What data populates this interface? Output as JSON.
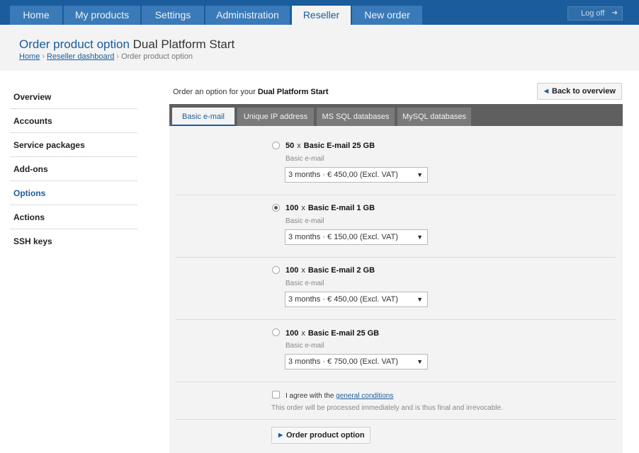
{
  "nav": {
    "tabs": [
      {
        "label": "Home"
      },
      {
        "label": "My products"
      },
      {
        "label": "Settings"
      },
      {
        "label": "Administration"
      },
      {
        "label": "Reseller",
        "active": true
      },
      {
        "label": "New order"
      }
    ],
    "logoff_label": "Log off",
    "logoff_icon": "arrow-right-icon"
  },
  "header": {
    "title_prefix": "Order product option",
    "title_product": "Dual Platform Start",
    "breadcrumb": {
      "home": "Home",
      "reseller": "Reseller dashboard",
      "current": "Order product option",
      "separator": "›"
    }
  },
  "sidebar": {
    "items": [
      {
        "label": "Overview"
      },
      {
        "label": "Accounts"
      },
      {
        "label": "Service packages"
      },
      {
        "label": "Add-ons"
      },
      {
        "label": "Options",
        "active": true
      },
      {
        "label": "Actions"
      },
      {
        "label": "SSH keys"
      }
    ]
  },
  "main": {
    "intro_prefix": "Order an option for your",
    "intro_product": "Dual Platform Start",
    "back_label": "Back to overview",
    "tabs": [
      {
        "label": "Basic e-mail",
        "active": true
      },
      {
        "label": "Unique IP address"
      },
      {
        "label": "MS SQL databases"
      },
      {
        "label": "MySQL databases"
      }
    ],
    "options": [
      {
        "qty": "50",
        "times": "x",
        "name": "Basic E-mail 25 GB",
        "category": "Basic e-mail",
        "price_select": "3 months · € 450,00 (Excl. VAT)",
        "selected": false
      },
      {
        "qty": "100",
        "times": "x",
        "name": "Basic E-mail 1 GB",
        "category": "Basic e-mail",
        "price_select": "3 months · € 150,00 (Excl. VAT)",
        "selected": true
      },
      {
        "qty": "100",
        "times": "x",
        "name": "Basic E-mail 2 GB",
        "category": "Basic e-mail",
        "price_select": "3 months · € 450,00 (Excl. VAT)",
        "selected": false
      },
      {
        "qty": "100",
        "times": "x",
        "name": "Basic E-mail 25 GB",
        "category": "Basic e-mail",
        "price_select": "3 months · € 750,00 (Excl. VAT)",
        "selected": false
      }
    ],
    "agree_prefix": "I agree with the",
    "agree_link": "general conditions",
    "note": "This order will be processed immediately and is thus final and irrevocable.",
    "order_label": "Order product option"
  },
  "colors": {
    "nav_bg": "#1a5c9c",
    "accent": "#1a5c9c",
    "panel_bg": "#f3f3f3",
    "tabbar_bg": "#5f5f5f"
  }
}
